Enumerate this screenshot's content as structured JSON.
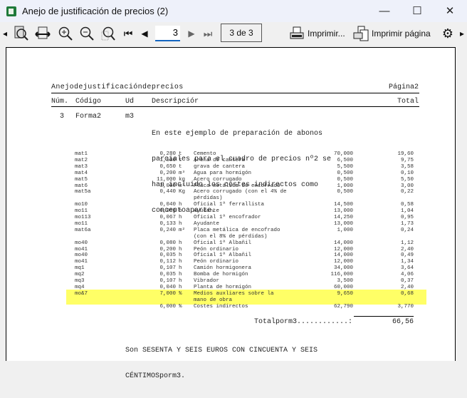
{
  "window": {
    "title": "Anejo de justificación de precios (2)",
    "minimize": "—",
    "maximize": "☐",
    "close": "✕"
  },
  "toolbar": {
    "page_input": "3",
    "page_count": "3 de 3",
    "print_label": "Imprimir...",
    "print_page_label": "Imprimir página"
  },
  "report": {
    "title": "Anejodejustificacióndeprecios",
    "page_label": "Página2",
    "headers": {
      "num": "Núm.",
      "code": "Código",
      "unit": "Ud",
      "desc": "Descripciór",
      "total": "Total"
    },
    "item": {
      "num": "3",
      "code": "Forma2",
      "unit": "m3",
      "desc": [
        "En este ejemplo de preparación de abonos",
        "parciales para el cuadro de precios nº2 se",
        "han incluido los costes indirectos como",
        "conceptoaparte."
      ]
    },
    "rows": [
      {
        "code": "mat1",
        "qty": "0,280",
        "unit": "t",
        "desc": [
          "Cemento"
        ],
        "price": "70,000",
        "total": "19,60"
      },
      {
        "code": "mat2",
        "qty": "1,500",
        "unit": "t",
        "desc": [
          "Arena de cantera"
        ],
        "price": "6,500",
        "total": "9,75"
      },
      {
        "code": "mat3",
        "qty": "0,650",
        "unit": "t",
        "desc": [
          "grava de cantera"
        ],
        "price": "5,500",
        "total": "3,58"
      },
      {
        "code": "mat4",
        "qty": "0,200",
        "unit": "m³",
        "desc": [
          "Agua para hormigón"
        ],
        "price": "0,500",
        "total": "0,10"
      },
      {
        "code": "mat5",
        "qty": "11,000",
        "unit": "kg",
        "desc": [
          "Acero corrugado"
        ],
        "price": "0,500",
        "total": "5,50"
      },
      {
        "code": "mat6",
        "qty": "3,000",
        "unit": "m²",
        "desc": [
          "Placa metálica de encofrado"
        ],
        "price": "1,000",
        "total": "3,00"
      },
      {
        "code": "mat5a",
        "qty": "0,440",
        "unit": "Kg",
        "desc": [
          "Acero corrugado (con el 4% de",
          "pérdidas)"
        ],
        "price": "0,500",
        "total": "0,22"
      },
      {
        "code": "mo10",
        "qty": "0,040",
        "unit": "h",
        "desc": [
          "Oficial 1ª ferrallista"
        ],
        "price": "14,500",
        "total": "0,58"
      },
      {
        "code": "mo11",
        "qty": "0,080",
        "unit": "h",
        "desc": [
          "Ayudante"
        ],
        "price": "13,000",
        "total": "1,04"
      },
      {
        "code": "mo113",
        "qty": "0,067",
        "unit": "h",
        "desc": [
          "Oficial 1ª encofrador"
        ],
        "price": "14,250",
        "total": "0,95"
      },
      {
        "code": "mo11",
        "qty": "0,133",
        "unit": "h",
        "desc": [
          "Ayudante"
        ],
        "price": "13,000",
        "total": "1,73"
      },
      {
        "code": "mat6a",
        "qty": "0,240",
        "unit": "m²",
        "desc": [
          "Placa metálica de encofrado",
          "(con el 8% de pérdidas)"
        ],
        "price": "1,000",
        "total": "0,24"
      },
      {
        "code": "mo40",
        "qty": "0,080",
        "unit": "h",
        "desc": [
          "Oficial 1ª Albañil"
        ],
        "price": "14,000",
        "total": "1,12"
      },
      {
        "code": "mo41",
        "qty": "0,200",
        "unit": "h",
        "desc": [
          "Peón ordinario"
        ],
        "price": "12,000",
        "total": "2,40"
      },
      {
        "code": "mo40",
        "qty": "0,035",
        "unit": "h",
        "desc": [
          "Oficial 1ª Albañil"
        ],
        "price": "14,000",
        "total": "0,49"
      },
      {
        "code": "mo41",
        "qty": "0,112",
        "unit": "h",
        "desc": [
          "Peón ordinario"
        ],
        "price": "12,000",
        "total": "1,34"
      },
      {
        "code": "mq1",
        "qty": "0,107",
        "unit": "h",
        "desc": [
          "Camión hormigonera"
        ],
        "price": "34,000",
        "total": "3,64"
      },
      {
        "code": "mq2",
        "qty": "0,035",
        "unit": "h",
        "desc": [
          "Bomba de hormigón"
        ],
        "price": "116,000",
        "total": "4,06"
      },
      {
        "code": "mq3",
        "qty": "0,107",
        "unit": "h",
        "desc": [
          "Vibrador"
        ],
        "price": "3,500",
        "total": "0,37"
      },
      {
        "code": "mq4",
        "qty": "0,040",
        "unit": "h",
        "desc": [
          "Planta de hormigón"
        ],
        "price": "60,000",
        "total": "2,40"
      },
      {
        "code": "mo&7",
        "qty": "7,000",
        "unit": "%",
        "desc": [
          "Medios auxliares sobre la",
          "mano de obra"
        ],
        "price": "9,650",
        "total": "0,68",
        "highlight": true
      },
      {
        "code": "",
        "qty": "6,000",
        "unit": "%",
        "desc": [
          "Costes indirectos"
        ],
        "price": "62,790",
        "total": "3,770"
      }
    ],
    "total_label": "Totalporm3............:",
    "total_value": "66,56",
    "words": [
      "Son SESENTA Y SEIS EUROS CON CINCUENTA Y SEIS",
      "CÉNTIMOSporm3."
    ]
  },
  "colors": {
    "highlight": "#ffff66"
  }
}
